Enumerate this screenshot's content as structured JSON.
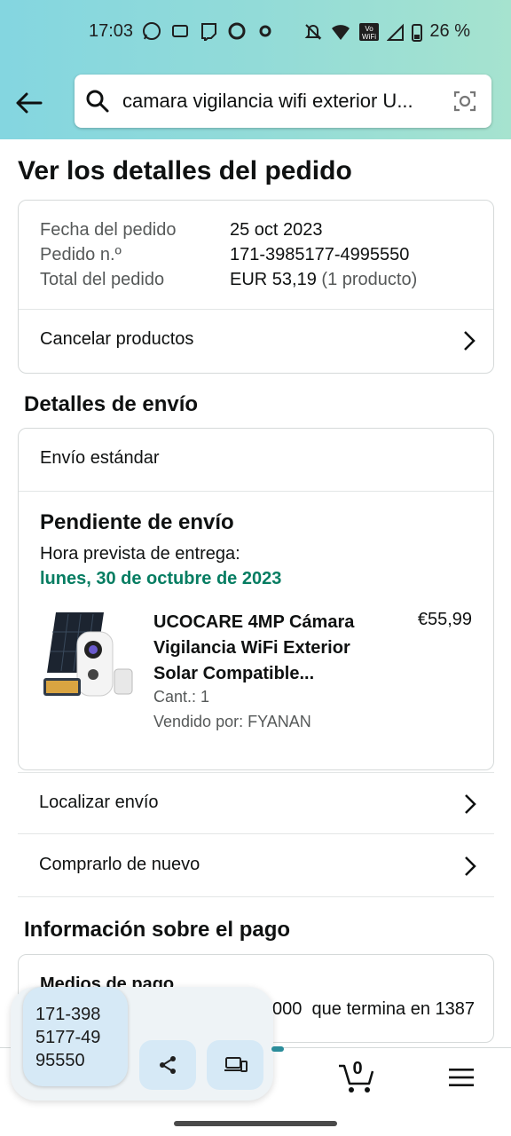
{
  "status_bar": {
    "time": "17:03",
    "battery": "26 %"
  },
  "search": {
    "query": "camara vigilancia wifi exterior U..."
  },
  "page_title": "Ver los detalles del pedido",
  "order": {
    "date_label": "Fecha del pedido",
    "date_value": "25 oct 2023",
    "number_label": "Pedido n.º",
    "number_value": "171-3985177-4995550",
    "total_label": "Total del pedido",
    "total_value": "EUR 53,19",
    "total_count": "(1 producto)",
    "cancel_label": "Cancelar productos"
  },
  "shipping": {
    "section_title": "Detalles de envío",
    "method": "Envío estándar",
    "status": "Pendiente de envío",
    "eta_label": "Hora prevista de entrega:",
    "eta_value": "lunes, 30 de octubre de 2023",
    "product": {
      "title_line1": "UCOCARE 4MP Cámara",
      "title_line2": "Vigilancia WiFi Exterior",
      "title_line3": "Solar Compatible...",
      "price": "€55,99",
      "qty": "Cant.: 1",
      "seller": "Vendido por: FYANAN"
    },
    "track_label": "Localizar envío",
    "buy_again_label": "Comprarlo de nuevo"
  },
  "payment": {
    "section_title": "Información sobre el pago",
    "method_title": "Medios de pago",
    "card_text": "d / 4B / Euro6000  que termina en 1387"
  },
  "nav": {
    "cart_count": "0"
  },
  "clipboard": {
    "line1": "171-398",
    "line2": "5177-49",
    "line3": "95550"
  },
  "colors": {
    "accent_green": "#067d62",
    "header_start": "#84d6e0",
    "header_end": "#a6e3cf"
  }
}
